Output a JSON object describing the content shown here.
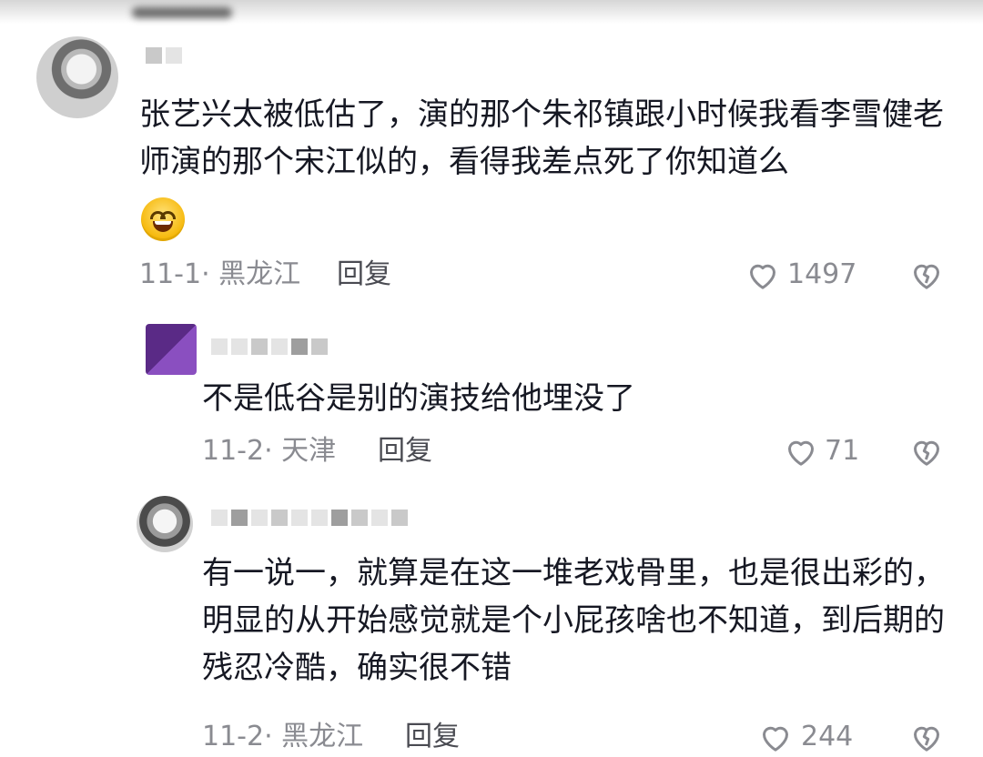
{
  "comments": [
    {
      "text": "张艺兴太被低估了，演的那个朱祁镇跟小时候我看李雪健老师演的那个宋江似的，看得我差点死了你知道么",
      "date_location": "11-1· 黑龙江",
      "reply_label": "回复",
      "likes": "1497",
      "emoji_icon": "grinning-face-icon"
    },
    {
      "text": "不是低谷是别的演技给他埋没了",
      "date_location": "11-2· 天津",
      "reply_label": "回复",
      "likes": "71"
    },
    {
      "text": "有一说一，就算是在这一堆老戏骨里，也是很出彩的，明显的从开始感觉就是个小屁孩啥也不知道，到后期的残忍冷酷，确实很不错",
      "date_location": "11-2· 黑龙江",
      "reply_label": "回复",
      "likes": "244"
    }
  ],
  "icons": {
    "like": "heart-outline-icon",
    "dislike": "broken-heart-icon"
  },
  "colors": {
    "text": "#161823",
    "meta": "#8a8b91",
    "icon": "#8a8b91"
  }
}
